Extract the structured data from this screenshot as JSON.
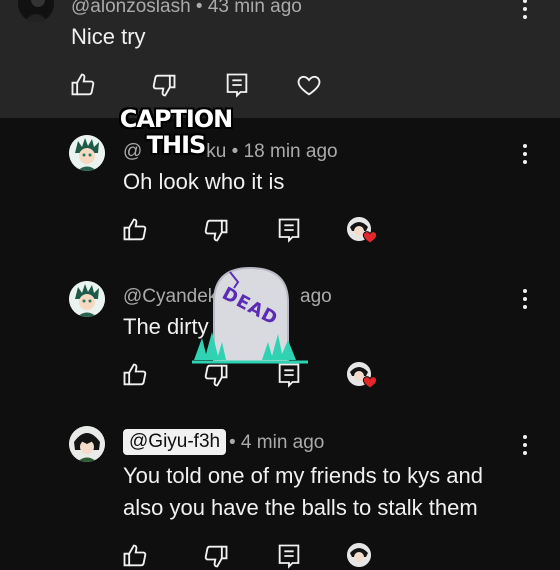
{
  "comments": [
    {
      "handle": "@alonzoslash",
      "time": "• 43 min ago",
      "text": "Nice try"
    },
    {
      "handle": "@",
      "handle_partial": "ku",
      "time": "• 18 min ago",
      "text": "Oh look who it is"
    },
    {
      "handle": "@Cyandek",
      "time": "ago",
      "text": "The dirty"
    },
    {
      "handle": "@Giyu-f3h",
      "time": "• 4 min ago",
      "text_line1": "You told one of my friends to kys and",
      "text_line2": "also you have the balls to stalk them"
    }
  ],
  "stickers": {
    "caption_line1": "CAPTION",
    "caption_line2": "THIS",
    "dead": "DEAD"
  },
  "colors": {
    "background": "#0f0f0f",
    "top_section": "#262626",
    "text": "#f1f1f1",
    "meta": "#aaaaaa",
    "heart": "#e3262b",
    "dead_text": "#5b2bb6"
  },
  "icons": [
    "like-icon",
    "dislike-icon",
    "reply-icon",
    "heart-icon",
    "more-vert-icon",
    "creator-heart-icon"
  ]
}
